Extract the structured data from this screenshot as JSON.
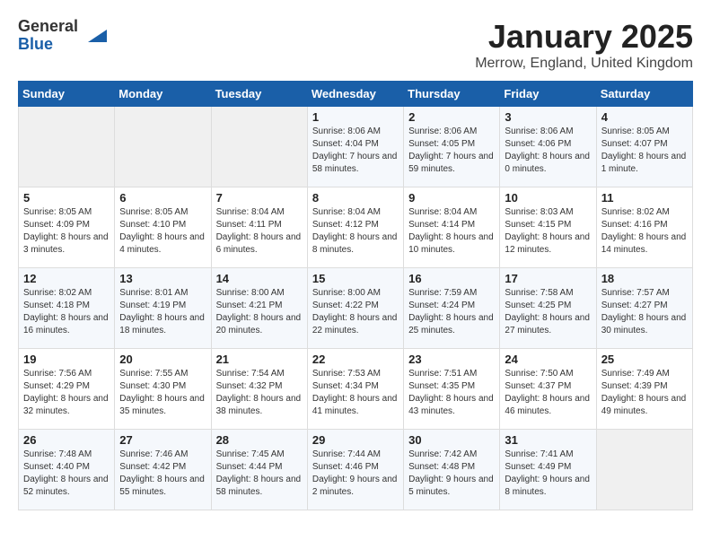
{
  "header": {
    "logo_general": "General",
    "logo_blue": "Blue",
    "title": "January 2025",
    "subtitle": "Merrow, England, United Kingdom"
  },
  "weekdays": [
    "Sunday",
    "Monday",
    "Tuesday",
    "Wednesday",
    "Thursday",
    "Friday",
    "Saturday"
  ],
  "weeks": [
    [
      {
        "day": "",
        "info": ""
      },
      {
        "day": "",
        "info": ""
      },
      {
        "day": "",
        "info": ""
      },
      {
        "day": "1",
        "info": "Sunrise: 8:06 AM\nSunset: 4:04 PM\nDaylight: 7 hours and 58 minutes."
      },
      {
        "day": "2",
        "info": "Sunrise: 8:06 AM\nSunset: 4:05 PM\nDaylight: 7 hours and 59 minutes."
      },
      {
        "day": "3",
        "info": "Sunrise: 8:06 AM\nSunset: 4:06 PM\nDaylight: 8 hours and 0 minutes."
      },
      {
        "day": "4",
        "info": "Sunrise: 8:05 AM\nSunset: 4:07 PM\nDaylight: 8 hours and 1 minute."
      }
    ],
    [
      {
        "day": "5",
        "info": "Sunrise: 8:05 AM\nSunset: 4:09 PM\nDaylight: 8 hours and 3 minutes."
      },
      {
        "day": "6",
        "info": "Sunrise: 8:05 AM\nSunset: 4:10 PM\nDaylight: 8 hours and 4 minutes."
      },
      {
        "day": "7",
        "info": "Sunrise: 8:04 AM\nSunset: 4:11 PM\nDaylight: 8 hours and 6 minutes."
      },
      {
        "day": "8",
        "info": "Sunrise: 8:04 AM\nSunset: 4:12 PM\nDaylight: 8 hours and 8 minutes."
      },
      {
        "day": "9",
        "info": "Sunrise: 8:04 AM\nSunset: 4:14 PM\nDaylight: 8 hours and 10 minutes."
      },
      {
        "day": "10",
        "info": "Sunrise: 8:03 AM\nSunset: 4:15 PM\nDaylight: 8 hours and 12 minutes."
      },
      {
        "day": "11",
        "info": "Sunrise: 8:02 AM\nSunset: 4:16 PM\nDaylight: 8 hours and 14 minutes."
      }
    ],
    [
      {
        "day": "12",
        "info": "Sunrise: 8:02 AM\nSunset: 4:18 PM\nDaylight: 8 hours and 16 minutes."
      },
      {
        "day": "13",
        "info": "Sunrise: 8:01 AM\nSunset: 4:19 PM\nDaylight: 8 hours and 18 minutes."
      },
      {
        "day": "14",
        "info": "Sunrise: 8:00 AM\nSunset: 4:21 PM\nDaylight: 8 hours and 20 minutes."
      },
      {
        "day": "15",
        "info": "Sunrise: 8:00 AM\nSunset: 4:22 PM\nDaylight: 8 hours and 22 minutes."
      },
      {
        "day": "16",
        "info": "Sunrise: 7:59 AM\nSunset: 4:24 PM\nDaylight: 8 hours and 25 minutes."
      },
      {
        "day": "17",
        "info": "Sunrise: 7:58 AM\nSunset: 4:25 PM\nDaylight: 8 hours and 27 minutes."
      },
      {
        "day": "18",
        "info": "Sunrise: 7:57 AM\nSunset: 4:27 PM\nDaylight: 8 hours and 30 minutes."
      }
    ],
    [
      {
        "day": "19",
        "info": "Sunrise: 7:56 AM\nSunset: 4:29 PM\nDaylight: 8 hours and 32 minutes."
      },
      {
        "day": "20",
        "info": "Sunrise: 7:55 AM\nSunset: 4:30 PM\nDaylight: 8 hours and 35 minutes."
      },
      {
        "day": "21",
        "info": "Sunrise: 7:54 AM\nSunset: 4:32 PM\nDaylight: 8 hours and 38 minutes."
      },
      {
        "day": "22",
        "info": "Sunrise: 7:53 AM\nSunset: 4:34 PM\nDaylight: 8 hours and 41 minutes."
      },
      {
        "day": "23",
        "info": "Sunrise: 7:51 AM\nSunset: 4:35 PM\nDaylight: 8 hours and 43 minutes."
      },
      {
        "day": "24",
        "info": "Sunrise: 7:50 AM\nSunset: 4:37 PM\nDaylight: 8 hours and 46 minutes."
      },
      {
        "day": "25",
        "info": "Sunrise: 7:49 AM\nSunset: 4:39 PM\nDaylight: 8 hours and 49 minutes."
      }
    ],
    [
      {
        "day": "26",
        "info": "Sunrise: 7:48 AM\nSunset: 4:40 PM\nDaylight: 8 hours and 52 minutes."
      },
      {
        "day": "27",
        "info": "Sunrise: 7:46 AM\nSunset: 4:42 PM\nDaylight: 8 hours and 55 minutes."
      },
      {
        "day": "28",
        "info": "Sunrise: 7:45 AM\nSunset: 4:44 PM\nDaylight: 8 hours and 58 minutes."
      },
      {
        "day": "29",
        "info": "Sunrise: 7:44 AM\nSunset: 4:46 PM\nDaylight: 9 hours and 2 minutes."
      },
      {
        "day": "30",
        "info": "Sunrise: 7:42 AM\nSunset: 4:48 PM\nDaylight: 9 hours and 5 minutes."
      },
      {
        "day": "31",
        "info": "Sunrise: 7:41 AM\nSunset: 4:49 PM\nDaylight: 9 hours and 8 minutes."
      },
      {
        "day": "",
        "info": ""
      }
    ]
  ]
}
